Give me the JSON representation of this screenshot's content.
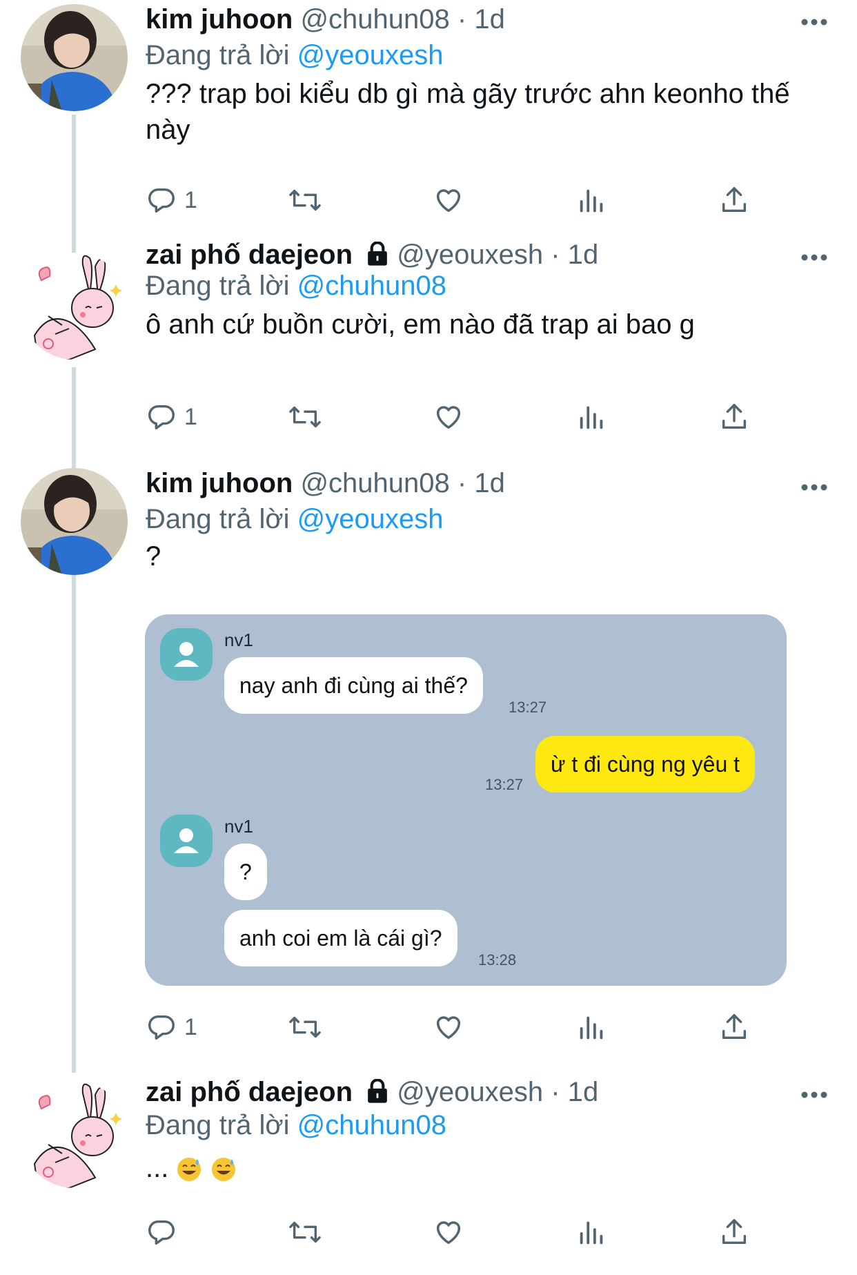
{
  "actions": {
    "reply_icon": "reply-icon",
    "retweet_icon": "retweet-icon",
    "like_icon": "heart-icon",
    "views_icon": "views-icon",
    "share_icon": "share-icon",
    "more_icon": "more-icon"
  },
  "colors": {
    "mention": "#1d9bf0",
    "chat_bg": "#aebfd2",
    "my_bubble": "#ffe812",
    "thread_line": "#cfd9de"
  },
  "tweets": [
    {
      "name": "kim juhoon",
      "handle": "@chuhun08",
      "dot": "·",
      "time": "1d",
      "replying_prefix": "Đang trả lời",
      "replying_to": "@yeouxesh",
      "text": "??? trap boi kiểu db gì mà gãy trước ahn keonho thế này",
      "reply_count": "1"
    },
    {
      "name": "zai phố daejeon",
      "handle": "@yeouxesh",
      "dot": "·",
      "time": "1d",
      "replying_prefix": "Đang trả lời",
      "replying_to": "@chuhun08",
      "text": "ô anh cứ buồn cười, em nào đã trap ai bao g",
      "reply_count": "1"
    },
    {
      "name": "kim juhoon",
      "handle": "@chuhun08",
      "dot": "·",
      "time": "1d",
      "replying_prefix": "Đang trả lời",
      "replying_to": "@yeouxesh",
      "text": "?",
      "reply_count": "1"
    },
    {
      "name": "zai phố daejeon",
      "handle": "@yeouxesh",
      "dot": "·",
      "time": "1d",
      "replying_prefix": "Đang trả lời",
      "replying_to": "@chuhun08",
      "text": "...",
      "reply_count": ""
    }
  ],
  "chat": {
    "sender_1": "nv1",
    "msg_1": "nay anh đi cùng ai thế?",
    "time_1": "13:27",
    "msg_2": "ừ t đi cùng ng yêu t",
    "time_2": "13:27",
    "sender_2": "nv1",
    "msg_3": "?",
    "msg_4": "anh coi em là cái gì?",
    "time_3": "13:28"
  }
}
